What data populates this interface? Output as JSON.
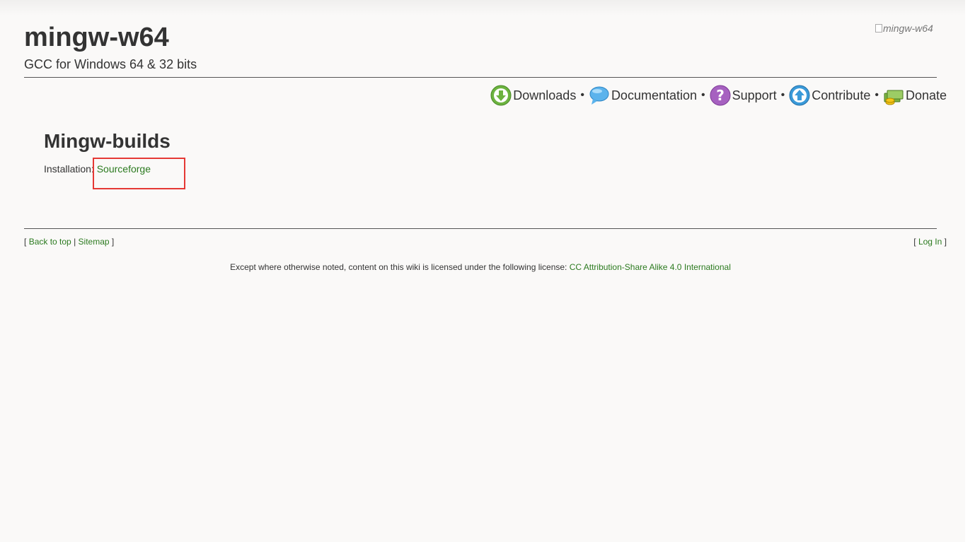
{
  "header": {
    "title": "mingw-w64",
    "subtitle": "GCC for Windows 64 & 32 bits",
    "logo_alt": "mingw-w64"
  },
  "nav": {
    "items": [
      {
        "label": "Downloads",
        "icon": "download-arrow-icon",
        "color": "#6cb33f"
      },
      {
        "label": "Documentation",
        "icon": "speech-bubble-icon",
        "color": "#3a9ad9"
      },
      {
        "label": "Support",
        "icon": "question-icon",
        "color": "#9b59b6"
      },
      {
        "label": "Contribute",
        "icon": "upload-arrow-icon",
        "color": "#3a9ad9"
      },
      {
        "label": "Donate",
        "icon": "money-icon",
        "color": "#8bc34a"
      }
    ],
    "separator": "•"
  },
  "main": {
    "heading": "Mingw-builds",
    "install_label": "Installation:",
    "install_link": "Sourceforge"
  },
  "footer": {
    "open_bracket": "[",
    "close_bracket": "]",
    "pipe": "|",
    "back_to_top": "Back to top",
    "sitemap": "Sitemap",
    "log_in": "Log In",
    "license_prefix": "Except where otherwise noted, content on this wiki is licensed under the following license:",
    "license_link": "CC Attribution-Share Alike 4.0 International"
  },
  "colors": {
    "link": "#2b7a1f",
    "highlight": "#e53935",
    "background": "#faf9f8"
  }
}
